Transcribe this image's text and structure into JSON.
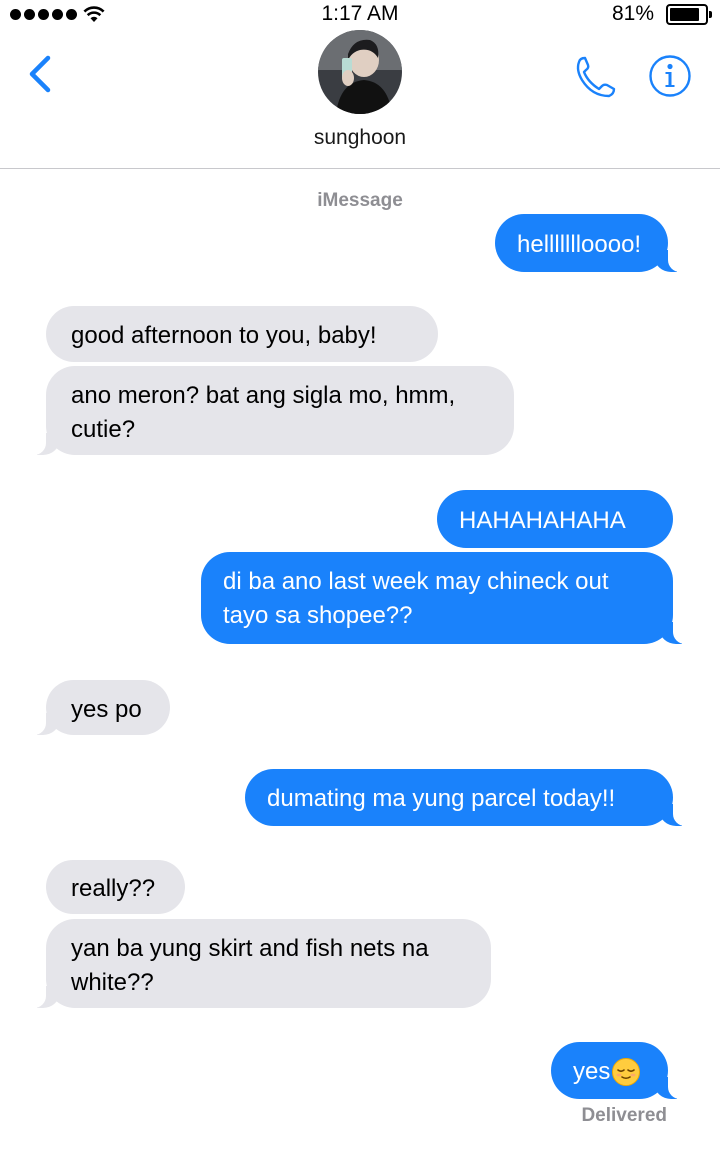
{
  "status_bar": {
    "time": "1:17 AM",
    "battery_percent": "81%",
    "battery_level": 0.81,
    "signal_bars": 5
  },
  "header": {
    "contact_name": "sunghoon",
    "back_icon": "chevron-left-icon",
    "call_icon": "phone-icon",
    "info_icon": "info-icon",
    "accent_color": "#1a82fb"
  },
  "conversation": {
    "service_label": "iMessage",
    "messages": [
      {
        "from": "me",
        "text": "hellllllloooo!"
      },
      {
        "from": "them",
        "text": "good afternoon to you, baby!"
      },
      {
        "from": "them",
        "lines": [
          "ano meron? bat ang sigla mo, hmm,",
          "cutie?"
        ]
      },
      {
        "from": "me",
        "text": "HAHAHAHAHA"
      },
      {
        "from": "me",
        "lines": [
          "di ba ano last week may chineck out",
          "tayo sa shopee??"
        ]
      },
      {
        "from": "them",
        "text": "yes po"
      },
      {
        "from": "me",
        "text": "dumating ma yung parcel today!!"
      },
      {
        "from": "them",
        "text": "really??"
      },
      {
        "from": "them",
        "lines": [
          "yan ba yung skirt and fish nets na",
          "white??"
        ]
      },
      {
        "from": "me",
        "text": "yes",
        "emoji": "relieved-face"
      }
    ],
    "delivery_status": "Delivered"
  },
  "colors": {
    "outgoing_bubble": "#1a82fb",
    "incoming_bubble": "#e5e5ea",
    "secondary_text": "#8e8e93"
  }
}
